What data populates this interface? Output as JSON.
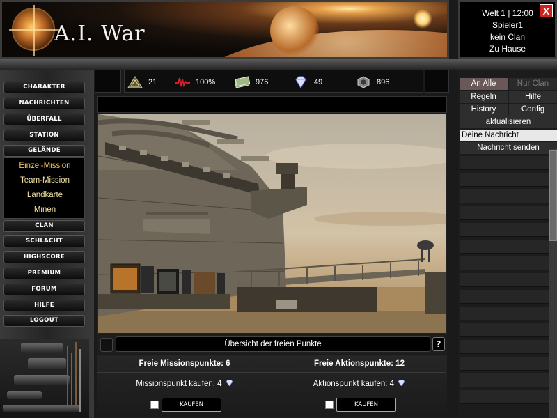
{
  "header": {
    "logo_text": "A.I. War"
  },
  "info": {
    "world_time": "Welt 1 | 12:00",
    "player": "Spieler1",
    "clan": "kein Clan",
    "location": "Zu Hause",
    "close_label": "X"
  },
  "resources": [
    {
      "icon": "rank-icon",
      "value": "21"
    },
    {
      "icon": "energy-pulse-icon",
      "value": "100%"
    },
    {
      "icon": "money-icon",
      "value": "976"
    },
    {
      "icon": "diamond-icon",
      "value": "49"
    },
    {
      "icon": "ore-icon",
      "value": "896"
    }
  ],
  "nav": {
    "items": [
      "CHARAKTER",
      "NACHRICHTEN",
      "ÜBERFALL",
      "STATION",
      "GELÄNDE"
    ],
    "sub_items": [
      "Einzel-Mission",
      "Team-Mission",
      "Landkarte",
      "Minen"
    ],
    "items_lower": [
      "CLAN",
      "SCHLACHT",
      "HIGHSCORE",
      "PREMIUM",
      "FORUM",
      "HILFE",
      "LOGOUT"
    ]
  },
  "main": {
    "overview_label": "Übersicht der freien Punkte",
    "help_label": "?",
    "mission": {
      "head": "Freie Missionspunkte: 6",
      "buy_text": "Missionspunkt kaufen: 4",
      "button_label": "KAUFEN"
    },
    "action": {
      "head": "Freie Aktionspunkte: 12",
      "buy_text": "Aktionspunkt kaufen: 4",
      "button_label": "KAUFEN"
    }
  },
  "chat": {
    "tab_all": "An Alle",
    "tab_clan": "Nur Clan",
    "rules": "Regeln",
    "help": "Hilfe",
    "history": "History",
    "config": "Config",
    "refresh": "aktualisieren",
    "message_placeholder": "Deine Nachricht",
    "send": "Nachricht senden"
  },
  "colors": {
    "accent_gold": "#f0c060",
    "close_red": "#d0211b",
    "tab_active_bg": "#5a4a4a"
  }
}
